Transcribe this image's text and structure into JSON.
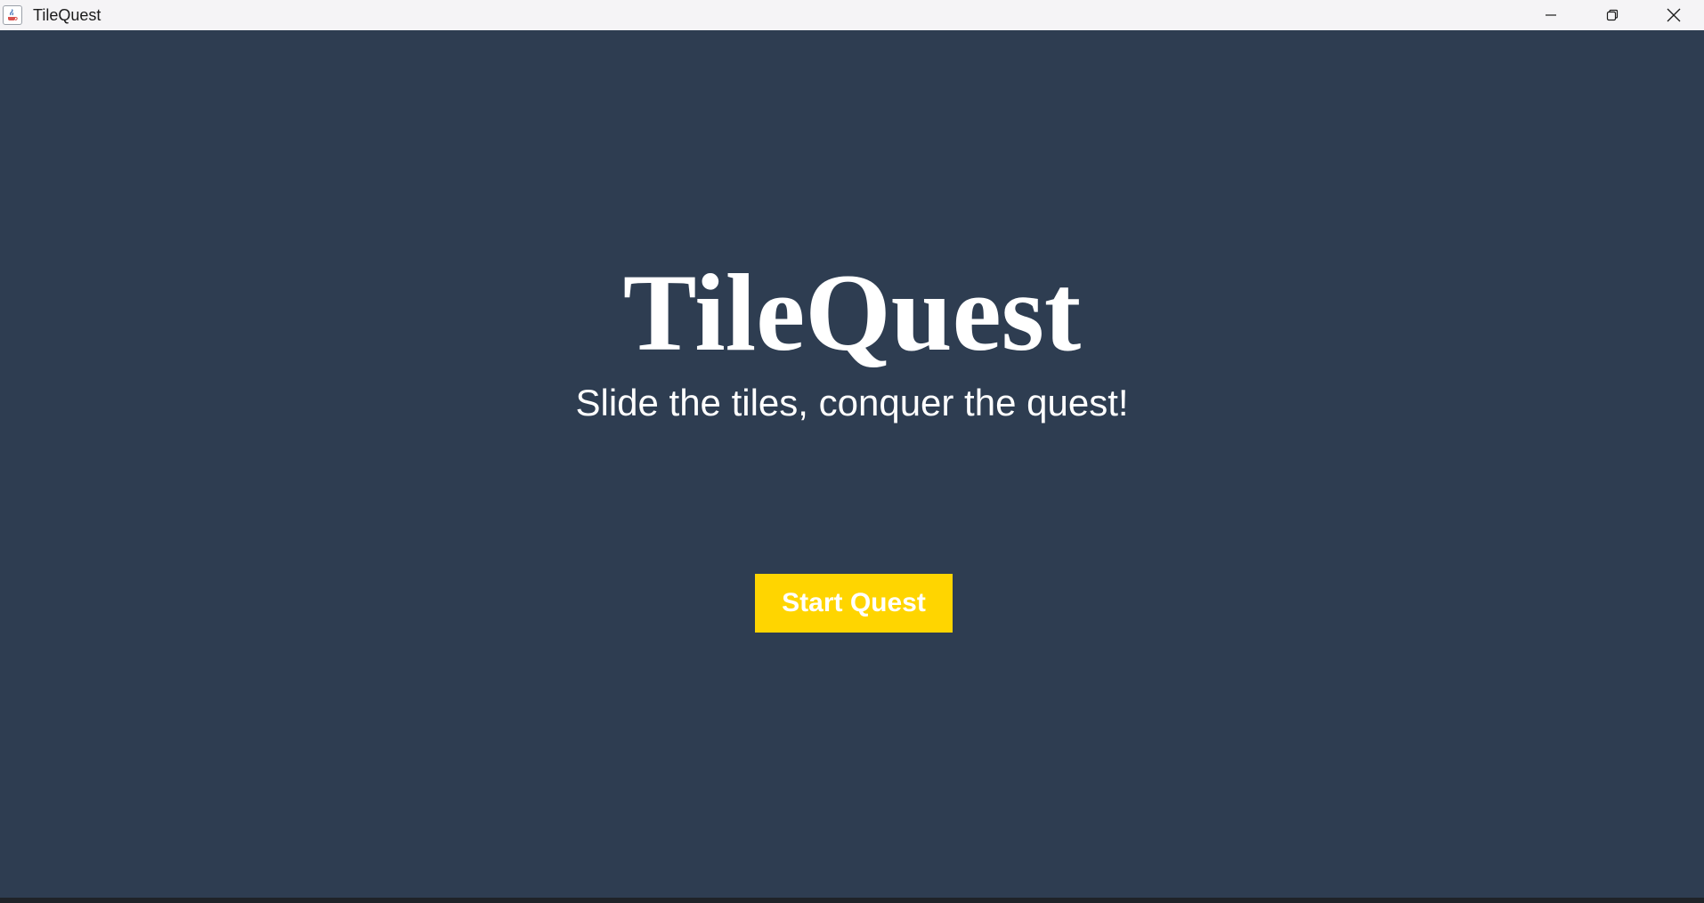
{
  "window": {
    "title": "TileQuest",
    "icon": "java-app-icon",
    "controls": {
      "minimize": "minimize-icon",
      "restore": "restore-icon",
      "close": "close-icon"
    }
  },
  "screen": {
    "title": "TileQuest",
    "tagline": "Slide the tiles, conquer the quest!",
    "start_button_label": "Start Quest"
  },
  "colors": {
    "background": "#2e3d51",
    "title_bar": "#f5f4f6",
    "button": "#ffd500",
    "text": "#ffffff"
  }
}
